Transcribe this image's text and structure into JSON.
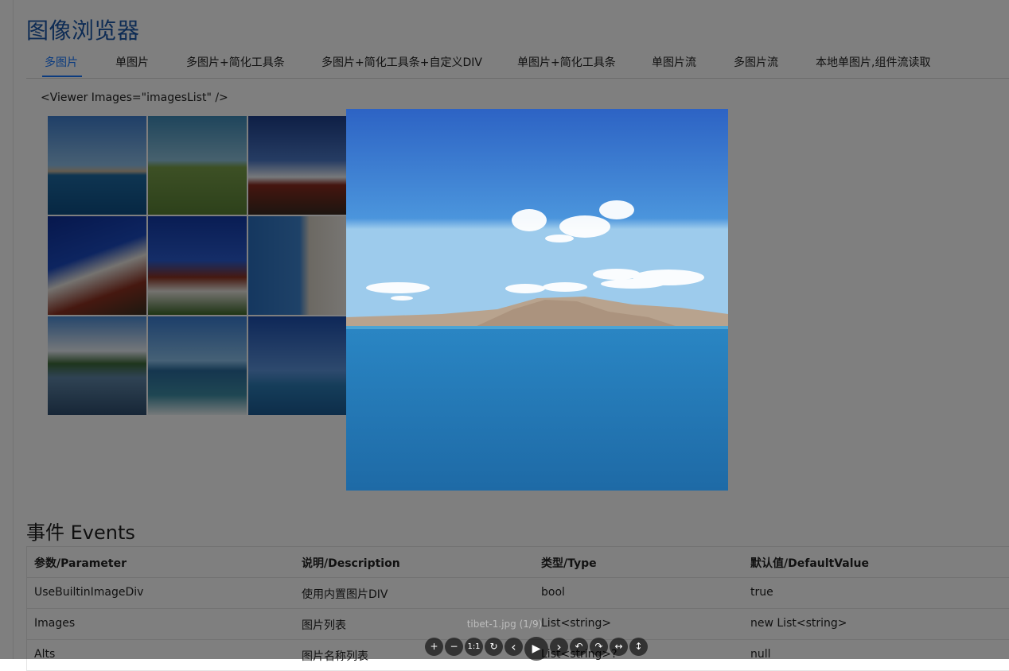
{
  "page": {
    "title": "图像浏览器",
    "tabs": [
      "多图片",
      "单图片",
      "多图片+简化工具条",
      "多图片+简化工具条+自定义DIV",
      "单图片+简化工具条",
      "单图片流",
      "多图片流",
      "本地单图片,组件流读取"
    ],
    "active_tab": "多图片",
    "code_line": "<Viewer Images=\"imagesList\" />"
  },
  "gallery": {
    "thumbnails": [
      "lake-mountain",
      "green-grassland",
      "monastery-roof",
      "potala-palace-1",
      "potala-palace-2",
      "palace-wall",
      "lakeside-village",
      "ocean-waves",
      "blue-sea"
    ]
  },
  "events": {
    "title": "事件 Events",
    "columns": [
      "参数/Parameter",
      "说明/Description",
      "类型/Type",
      "默认值/DefaultValue"
    ],
    "rows": [
      [
        "UseBuiltinImageDiv",
        "使用内置图片DIV",
        "bool",
        "true"
      ],
      [
        "Images",
        "图片列表",
        "List<string>",
        "new List<string>"
      ],
      [
        "Alts",
        "图片名称列表",
        "List<string>?",
        "null"
      ]
    ]
  },
  "viewer": {
    "caption": "tibet-1.jpg (1/9)",
    "toolbar": {
      "zoom_in": "+",
      "zoom_out": "−",
      "one_to_one": "1:1",
      "reset": "↻",
      "prev": "‹",
      "play": "▶",
      "next": "›",
      "rotate_left": "↶",
      "rotate_right": "↷",
      "flip_horizontal": "↔",
      "flip_vertical": "↕"
    }
  },
  "colors": {
    "accent": "#1677ff",
    "title": "#1a56a8",
    "overlay": "rgba(0,0,0,0.5)"
  }
}
